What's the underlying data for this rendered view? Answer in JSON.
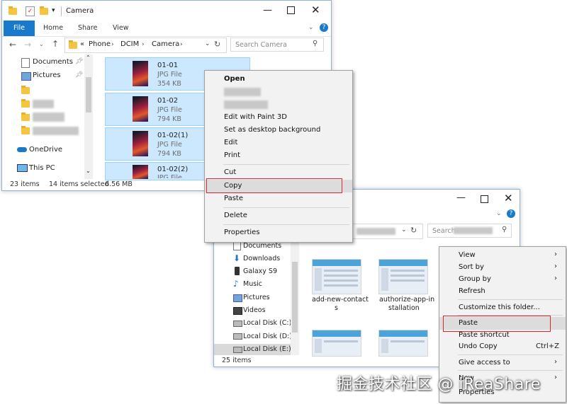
{
  "window1": {
    "title": "Camera",
    "tabs": {
      "file": "File",
      "home": "Home",
      "share": "Share",
      "view": "View"
    },
    "address": {
      "prefix": "«",
      "crumbs": [
        "Phone",
        "DCIM",
        "Camera"
      ]
    },
    "search_placeholder": "Search Camera",
    "nav": [
      {
        "label": "Documents",
        "icon": "documents-icon",
        "pinned": true
      },
      {
        "label": "Pictures",
        "icon": "pictures-icon",
        "pinned": true
      },
      {
        "label": "OneDrive",
        "icon": "onedrive-icon"
      },
      {
        "label": "This PC",
        "icon": "this-pc-icon"
      }
    ],
    "files": [
      {
        "name": "01-01",
        "type": "JPG File",
        "size": "354 KB"
      },
      {
        "name": "01-02",
        "type": "JPG File",
        "size": "794 KB"
      },
      {
        "name": "01-02(1)",
        "type": "JPG File",
        "size": "794 KB"
      },
      {
        "name": "01-02(2)",
        "type": "JPG File",
        "size": ""
      }
    ],
    "status": {
      "count": "23 items",
      "selected": "14 items selected",
      "size": "6.56 MB"
    }
  },
  "menu1": {
    "items": [
      "Open",
      "Edit with Paint 3D",
      "Set as desktop background",
      "Edit",
      "Print",
      "Cut",
      "Copy",
      "Paste",
      "Delete",
      "Properties"
    ],
    "highlighted": "Copy"
  },
  "window2": {
    "search_placeholder": "Search",
    "nav": [
      {
        "label": "Documents",
        "icon": "documents-icon"
      },
      {
        "label": "Downloads",
        "icon": "downloads-icon"
      },
      {
        "label": "Galaxy S9",
        "icon": "phone-icon"
      },
      {
        "label": "Music",
        "icon": "music-icon"
      },
      {
        "label": "Pictures",
        "icon": "pictures-icon"
      },
      {
        "label": "Videos",
        "icon": "videos-icon"
      },
      {
        "label": "Local Disk (C:)",
        "icon": "disk-icon"
      },
      {
        "label": "Local Disk (D:)",
        "icon": "disk-icon"
      },
      {
        "label": "Local Disk (E:)",
        "icon": "disk-icon"
      }
    ],
    "grid": [
      {
        "label1": "add-new-contact",
        "label2": "s"
      },
      {
        "label1": "authorize-app-in",
        "label2": "stallation"
      }
    ],
    "status": {
      "count": "25 items"
    }
  },
  "menu2": {
    "items": [
      {
        "label": "View",
        "submenu": true
      },
      {
        "label": "Sort by",
        "submenu": true
      },
      {
        "label": "Group by",
        "submenu": true
      },
      {
        "label": "Refresh"
      },
      {
        "label": "Customize this folder..."
      },
      {
        "label": "Paste"
      },
      {
        "label": "Paste shortcut"
      },
      {
        "label": "Undo Copy",
        "shortcut": "Ctrl+Z"
      },
      {
        "label": "Give access to",
        "submenu": true
      },
      {
        "label": "New",
        "submenu": true
      },
      {
        "label": "Properties"
      }
    ],
    "highlighted": "Paste"
  },
  "watermark": "掘金技术社区 @ iReaShare",
  "colors": {
    "accent": "#1979ca",
    "selection": "#cce8ff",
    "highlight_border": "#e0262b"
  }
}
